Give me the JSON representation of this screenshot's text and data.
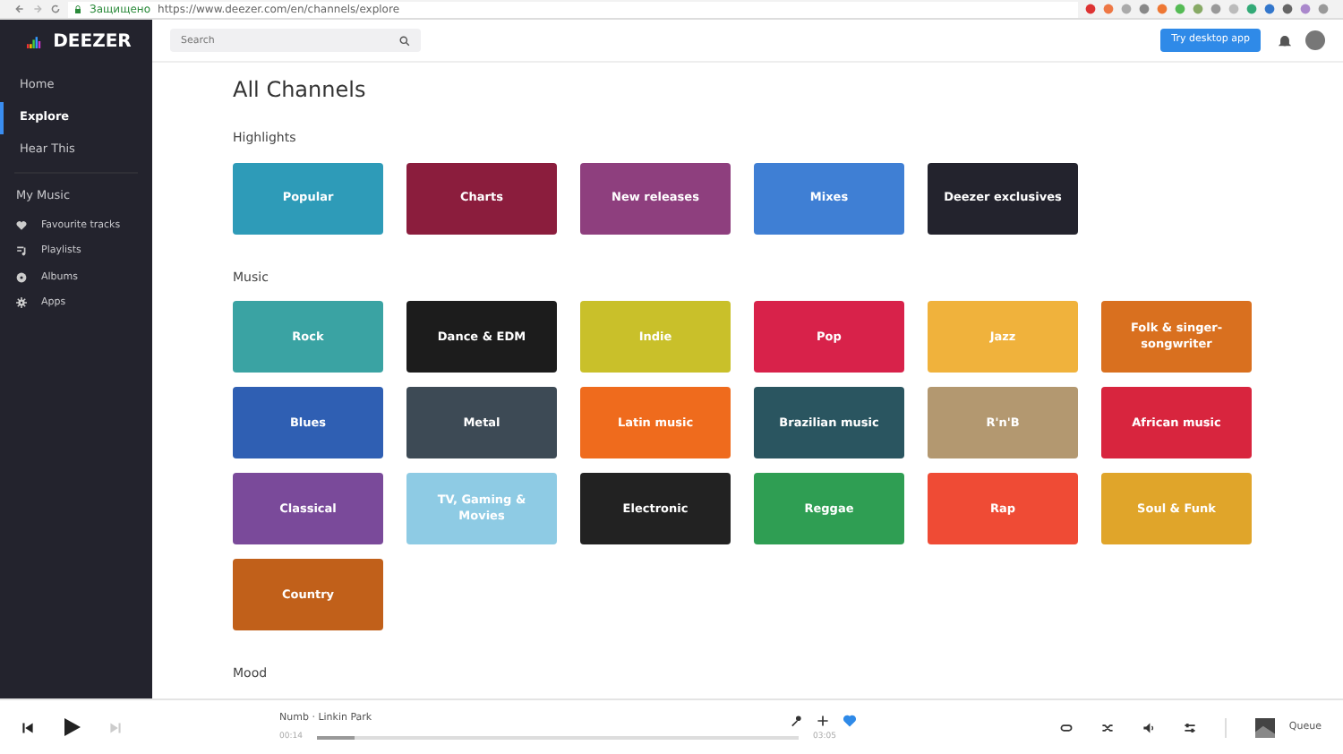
{
  "browser": {
    "security_label": "Защищено",
    "url": "https://www.deezer.com/en/channels/explore"
  },
  "header": {
    "logo": "DEEZER",
    "search": {
      "placeholder": "Search"
    },
    "cta": "Try desktop app"
  },
  "sidebar": {
    "nav": [
      {
        "label": "Home",
        "selected": false
      },
      {
        "label": "Explore",
        "selected": true
      },
      {
        "label": "Hear This",
        "selected": false
      }
    ],
    "section_title": "My Music",
    "library": [
      {
        "label": "Favourite tracks",
        "kind": "heart"
      },
      {
        "label": "Playlists",
        "kind": "playlist"
      },
      {
        "label": "Albums",
        "kind": "album"
      },
      {
        "label": "Apps",
        "kind": "apps"
      }
    ]
  },
  "page_title": "All Channels",
  "sections": [
    {
      "title": "Highlights",
      "tiles": [
        {
          "label": "Popular",
          "color": "#2e9bb8"
        },
        {
          "label": "Charts",
          "color": "#8b1d3d"
        },
        {
          "label": "New releases",
          "color": "#8e3f7e"
        },
        {
          "label": "Mixes",
          "color": "#3f7fd4"
        },
        {
          "label": "Deezer exclusives",
          "color": "#23232d"
        }
      ]
    },
    {
      "title": "Music",
      "tiles": [
        {
          "label": "Rock",
          "color": "#3aa3a3"
        },
        {
          "label": "Dance & EDM",
          "color": "#1c1c1c"
        },
        {
          "label": "Indie",
          "color": "#c9c02a"
        },
        {
          "label": "Pop",
          "color": "#d8224a"
        },
        {
          "label": "Jazz",
          "color": "#f0b23c"
        },
        {
          "label": "Folk & singer-songwriter",
          "color": "#d9701f"
        },
        {
          "label": "Blues",
          "color": "#2f5fb3"
        },
        {
          "label": "Metal",
          "color": "#3d4a55"
        },
        {
          "label": "Latin music",
          "color": "#ef6b1d"
        },
        {
          "label": "Brazilian music",
          "color": "#2a5560"
        },
        {
          "label": "R'n'B",
          "color": "#b39870"
        },
        {
          "label": "African music",
          "color": "#d8253e"
        },
        {
          "label": "Classical",
          "color": "#7a4a9a"
        },
        {
          "label": "TV, Gaming & Movies",
          "color": "#8ecbe4"
        },
        {
          "label": "Electronic",
          "color": "#222222"
        },
        {
          "label": "Reggae",
          "color": "#2f9e53"
        },
        {
          "label": "Rap",
          "color": "#ef4b35"
        },
        {
          "label": "Soul & Funk",
          "color": "#e0a52a"
        },
        {
          "label": "Country",
          "color": "#c1601a"
        }
      ]
    },
    {
      "title": "Mood"
    }
  ],
  "player": {
    "track": "Numb · Linkin Park",
    "elapsed": "00:14",
    "duration": "03:05",
    "level": 0.08,
    "liked": true,
    "queue_label": "Queue"
  }
}
